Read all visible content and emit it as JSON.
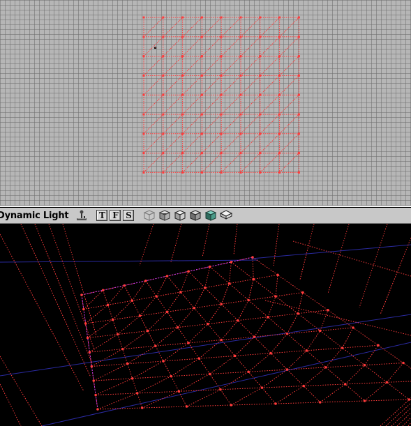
{
  "toolbar": {
    "viewport_mode": "Dynamic Light",
    "view_buttons": [
      "T",
      "F",
      "S"
    ],
    "icons": [
      "joystick-icon",
      "wireframe-cube-icon",
      "zone-cube-icon",
      "texture-cube-icon",
      "flat-shaded-cube-icon",
      "dynamic-light-cube-icon",
      "unlit-cube-icon"
    ]
  },
  "colors": {
    "grid_background": "#b6b6b6",
    "grid_line": "#6e6e6e",
    "mesh_line": "#ff3b3b",
    "perspective_background": "#000000",
    "perspective_world_line": "#2a2aa0",
    "mesh_highlight": "#c83cff"
  }
}
